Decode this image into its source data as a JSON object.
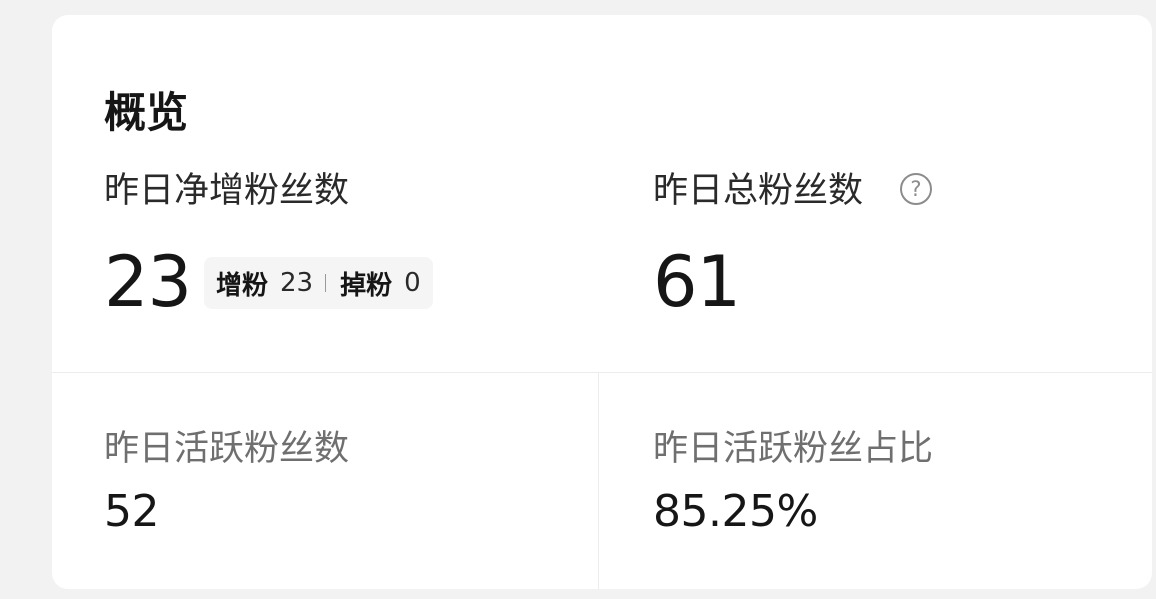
{
  "overview": {
    "title": "概览",
    "net_new_followers": {
      "label": "昨日净增粉丝数",
      "value": "23",
      "gain_label": "增粉",
      "gain_value": "23",
      "loss_label": "掉粉",
      "loss_value": "0"
    },
    "total_followers": {
      "label": "昨日总粉丝数",
      "value": "61",
      "help_icon": "question-circle-icon"
    },
    "active_followers": {
      "label": "昨日活跃粉丝数",
      "value": "52"
    },
    "active_ratio": {
      "label": "昨日活跃粉丝占比",
      "value": "85.25%"
    }
  },
  "colors": {
    "background": "#f2f2f2",
    "card": "#ffffff",
    "text_primary": "#161616",
    "text_muted": "#6f6f6f",
    "pill_background": "#f5f5f5",
    "divider": "#ececec"
  }
}
